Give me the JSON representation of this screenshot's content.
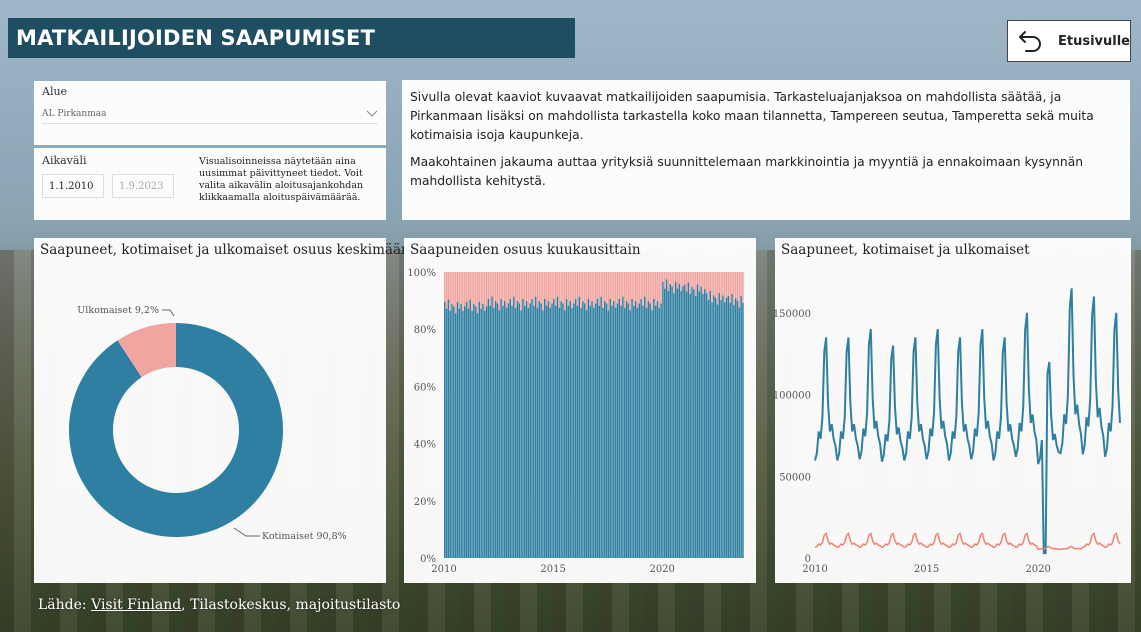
{
  "header": {
    "title": "MATKAILIJOIDEN SAAPUMISET",
    "home_label": "Etusivulle"
  },
  "filters": {
    "region_label": "Alue",
    "region_value": "AL Pirkanmaa",
    "period_label": "Aikaväli",
    "start_date": "1.1.2010",
    "end_date": "1.9.2023",
    "period_note": "Visualisoinneissa näytetään aina uusimmat päivittyneet tiedot. Voit valita aikavälin aloitusajankohdan klikkaamalla aloituspäivämäärää."
  },
  "description": {
    "p1": "Sivulla olevat kaaviot kuvaavat matkailijoiden saapumisia. Tarkasteluajanjaksoa on mahdollista säätää, ja Pirkanmaan lisäksi on mahdollista tarkastella koko maan tilannetta, Tampereen seutua, Tamperetta sekä muita kotimaisia isoja kaupunkeja.",
    "p2": "Maakohtainen jakauma auttaa yrityksiä suunnittelemaan markkinointia ja myyntiä ja ennakoimaan kysynnän mahdollista kehitystä."
  },
  "source": {
    "prefix": "Lähde: ",
    "link": "Visit Finland",
    "rest": ", Tilastokeskus, majoitustilasto"
  },
  "colors": {
    "domestic": "#2e7fa1",
    "foreign": "#f1a5a0",
    "title_bg": "#1f4e63"
  },
  "chart_data": [
    {
      "type": "pie",
      "title": "Saapuneet, kotimaiset ja ulkomaiset osuus keskimäärin",
      "slices": [
        {
          "name": "Kotimaiset",
          "value": 90.8,
          "label": "Kotimaiset 90,8%"
        },
        {
          "name": "Ulkomaiset",
          "value": 9.2,
          "label": "Ulkomaiset 9,2%"
        }
      ]
    },
    {
      "type": "bar",
      "stacked": "percent",
      "title": "Saapuneiden osuus kuukausittain",
      "x_ticks": [
        "2010",
        "2015",
        "2020"
      ],
      "y_ticks": [
        "0%",
        "20%",
        "40%",
        "60%",
        "80%",
        "100%"
      ],
      "ylim": [
        0,
        100
      ],
      "domestic_share_by_year": {
        "2010": 88,
        "2011": 88,
        "2012": 89,
        "2013": 89,
        "2014": 89,
        "2015": 89,
        "2016": 89,
        "2017": 89,
        "2018": 89,
        "2019": 89,
        "2020": 95,
        "2021": 94,
        "2022": 91,
        "2023": 90
      }
    },
    {
      "type": "line",
      "title": "Saapuneet, kotimaiset ja ulkomaiset",
      "x_ticks": [
        "2010",
        "2015",
        "2020"
      ],
      "y_ticks": [
        "0",
        "50000",
        "100000",
        "150000"
      ],
      "ylim": [
        0,
        175000
      ],
      "series": [
        {
          "key": "domestic",
          "yearly_peak": {
            "2010": 135000,
            "2011": 135000,
            "2012": 140000,
            "2013": 130000,
            "2014": 135000,
            "2015": 140000,
            "2016": 135000,
            "2017": 140000,
            "2018": 135000,
            "2019": 150000,
            "2020": 120000,
            "2021": 165000,
            "2022": 160000,
            "2023": 150000
          },
          "yearly_trough": 58000
        },
        {
          "key": "foreign",
          "yearly_peak": 15000,
          "yearly_trough": 5000
        }
      ]
    }
  ]
}
